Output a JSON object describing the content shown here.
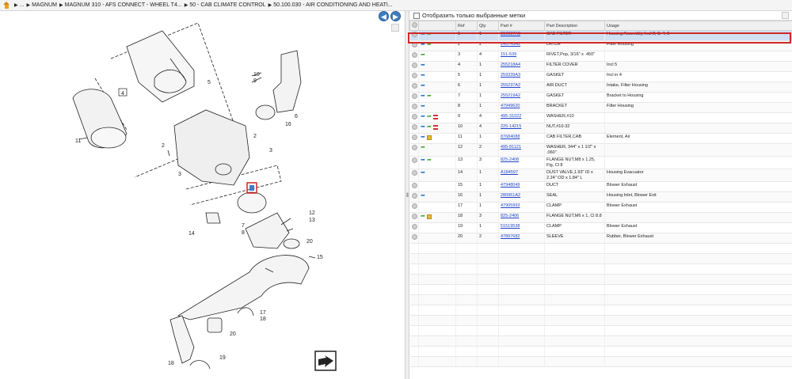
{
  "breadcrumb": [
    {
      "label": "..."
    },
    {
      "label": "MAGNUM"
    },
    {
      "label": "MAGNUM 310 - AFS CONNECT - WHEEL T4..."
    },
    {
      "label": "50 - CAB CLIMATE CONTROL"
    },
    {
      "label": "50.100.030 - AIR CONDITIONING AND HEATI..."
    }
  ],
  "nav": {
    "back": "◀",
    "forward": "▶"
  },
  "filter": {
    "label": "Отобразить только выбранные метки"
  },
  "table": {
    "headers": {
      "ref": "Ref",
      "qty": "Qty",
      "part": "Part #",
      "desc": "Part Description",
      "usage": "Usage"
    },
    "rows": [
      {
        "ref": "1",
        "qty": "1",
        "part": "310687A3",
        "desc": "CAB FILTER",
        "usage": "Housing Assembly, Incl 2, 3, 4, 5",
        "icons": [
          "blue",
          "green"
        ],
        "selected": true
      },
      {
        "ref": "2",
        "qty": "2",
        "part": "240745A2",
        "desc": "LATCH",
        "usage": "Filter Housing",
        "icons": [
          "blue",
          "green"
        ]
      },
      {
        "ref": "3",
        "qty": "4",
        "part": "151-539",
        "desc": "RIVET,Pop, 3/16\" x .450\"",
        "usage": "",
        "icons": [
          "green"
        ]
      },
      {
        "ref": "4",
        "qty": "1",
        "part": "255218A4",
        "desc": "FILTER COVER",
        "usage": "Incl 5",
        "icons": [
          "blue"
        ]
      },
      {
        "ref": "5",
        "qty": "1",
        "part": "259339A3",
        "desc": "GASKET",
        "usage": "Incl in 4",
        "icons": [
          "blue"
        ]
      },
      {
        "ref": "6",
        "qty": "1",
        "part": "255237A2",
        "desc": "AIR DUCT",
        "usage": "Intake, Filter Housing",
        "icons": [
          "blue"
        ]
      },
      {
        "ref": "7",
        "qty": "1",
        "part": "255219A2",
        "desc": "GASKET",
        "usage": "Bracket to Housing",
        "icons": [
          "blue",
          "green"
        ]
      },
      {
        "ref": "8",
        "qty": "1",
        "part": "47949620",
        "desc": "BRACKET",
        "usage": "Filter Housing",
        "icons": [
          "blue"
        ]
      },
      {
        "ref": "9",
        "qty": "4",
        "part": "495-31022",
        "desc": "WASHER,#10",
        "usage": "",
        "icons": [
          "blue",
          "green",
          "red"
        ]
      },
      {
        "ref": "10",
        "qty": "4",
        "part": "225-14215",
        "desc": "NUT,#10-32",
        "usage": "",
        "icons": [
          "blue",
          "green",
          "red"
        ]
      },
      {
        "ref": "11",
        "qty": "1",
        "part": "87684088",
        "desc": "CAB FILTER,CAB",
        "usage": "Element, Air",
        "icons": [
          "blue",
          "box"
        ]
      },
      {
        "ref": "12",
        "qty": "2",
        "part": "495-81121",
        "desc": "WASHER, 344\" x 1 1/2\" x .060\"",
        "usage": "",
        "icons": [
          "green"
        ]
      },
      {
        "ref": "13",
        "qty": "3",
        "part": "825-2408",
        "desc": "FLANGE NUT,M8 x 1.25, Flg, Cl 8",
        "usage": "",
        "icons": [
          "blue",
          "green"
        ]
      },
      {
        "ref": "14",
        "qty": "1",
        "part": "A184597",
        "desc": "DUST VALVE,1.93\" ID x 2.24\" OD x 1.84\" L",
        "usage": "Housing Evacuator",
        "icons": [
          "blue"
        ]
      },
      {
        "ref": "15",
        "qty": "1",
        "part": "47948049",
        "desc": "DUCT",
        "usage": "Blower Exhaust",
        "icons": []
      },
      {
        "ref": "16",
        "qty": "1",
        "part": "280951A2",
        "desc": "SEAL",
        "usage": "Housing Inlet, Blower Exit",
        "icons": [
          "blue"
        ]
      },
      {
        "ref": "17",
        "qty": "1",
        "part": "47905993",
        "desc": "CLAMP",
        "usage": "Blower Exhaust",
        "icons": []
      },
      {
        "ref": "18",
        "qty": "3",
        "part": "825-2406",
        "desc": "FLANGE NUT,M6 x 1, Cl 8.8",
        "usage": "",
        "icons": [
          "green",
          "box"
        ]
      },
      {
        "ref": "19",
        "qty": "1",
        "part": "51519538",
        "desc": "CLAMP",
        "usage": "Blower Exhaust",
        "icons": []
      },
      {
        "ref": "20",
        "qty": "2",
        "part": "47897682",
        "desc": "SLEEVE",
        "usage": "Rubber, Blower Exhaust",
        "icons": []
      }
    ]
  },
  "diagram": {
    "labels": [
      "1",
      "2",
      "3",
      "2",
      "3",
      "4",
      "5",
      "6",
      "7",
      "8",
      "9",
      "10",
      "11",
      "12",
      "13",
      "14",
      "15",
      "16",
      "17",
      "18",
      "18",
      "19",
      "20",
      "20"
    ]
  }
}
